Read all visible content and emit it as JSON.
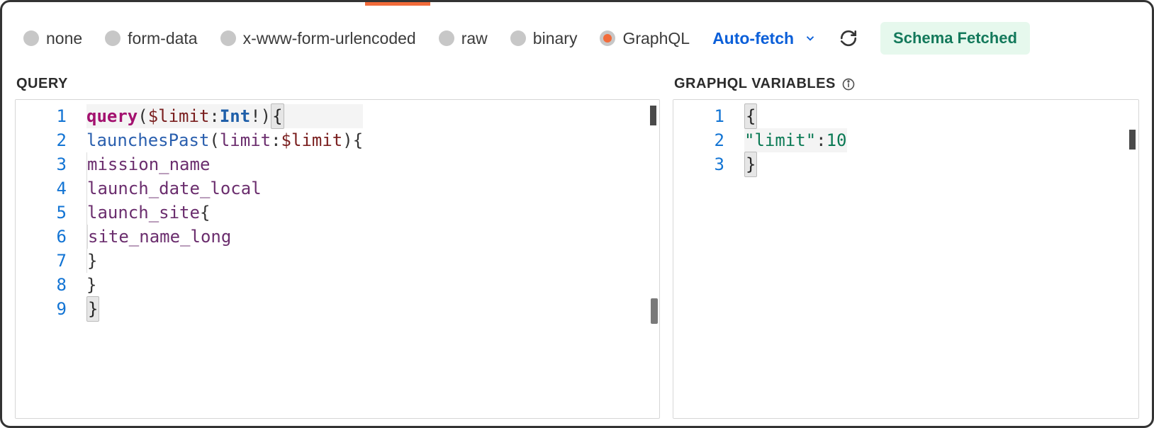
{
  "body_types": {
    "options": [
      {
        "id": "none",
        "label": "none",
        "selected": false
      },
      {
        "id": "form",
        "label": "form-data",
        "selected": false
      },
      {
        "id": "xwww",
        "label": "x-www-form-urlencoded",
        "selected": false
      },
      {
        "id": "raw",
        "label": "raw",
        "selected": false
      },
      {
        "id": "bin",
        "label": "binary",
        "selected": false
      },
      {
        "id": "gql",
        "label": "GraphQL",
        "selected": true
      }
    ]
  },
  "auto_fetch_label": "Auto-fetch",
  "schema_status": "Schema Fetched",
  "query": {
    "title": "QUERY",
    "lines": [
      "query ($limit: Int!){",
      "    launchesPast(limit: $limit) {",
      "        mission_name",
      "        launch_date_local",
      "        launch_site {",
      "            site_name_long",
      "        }",
      "    }",
      "}"
    ]
  },
  "variables": {
    "title": "GRAPHQL VARIABLES",
    "lines": [
      "{",
      "    \"limit\": 10",
      "}"
    ],
    "lines_struct": [
      {
        "type": "open"
      },
      {
        "type": "pair",
        "key": "\"limit\"",
        "value": "10"
      },
      {
        "type": "close"
      }
    ]
  }
}
